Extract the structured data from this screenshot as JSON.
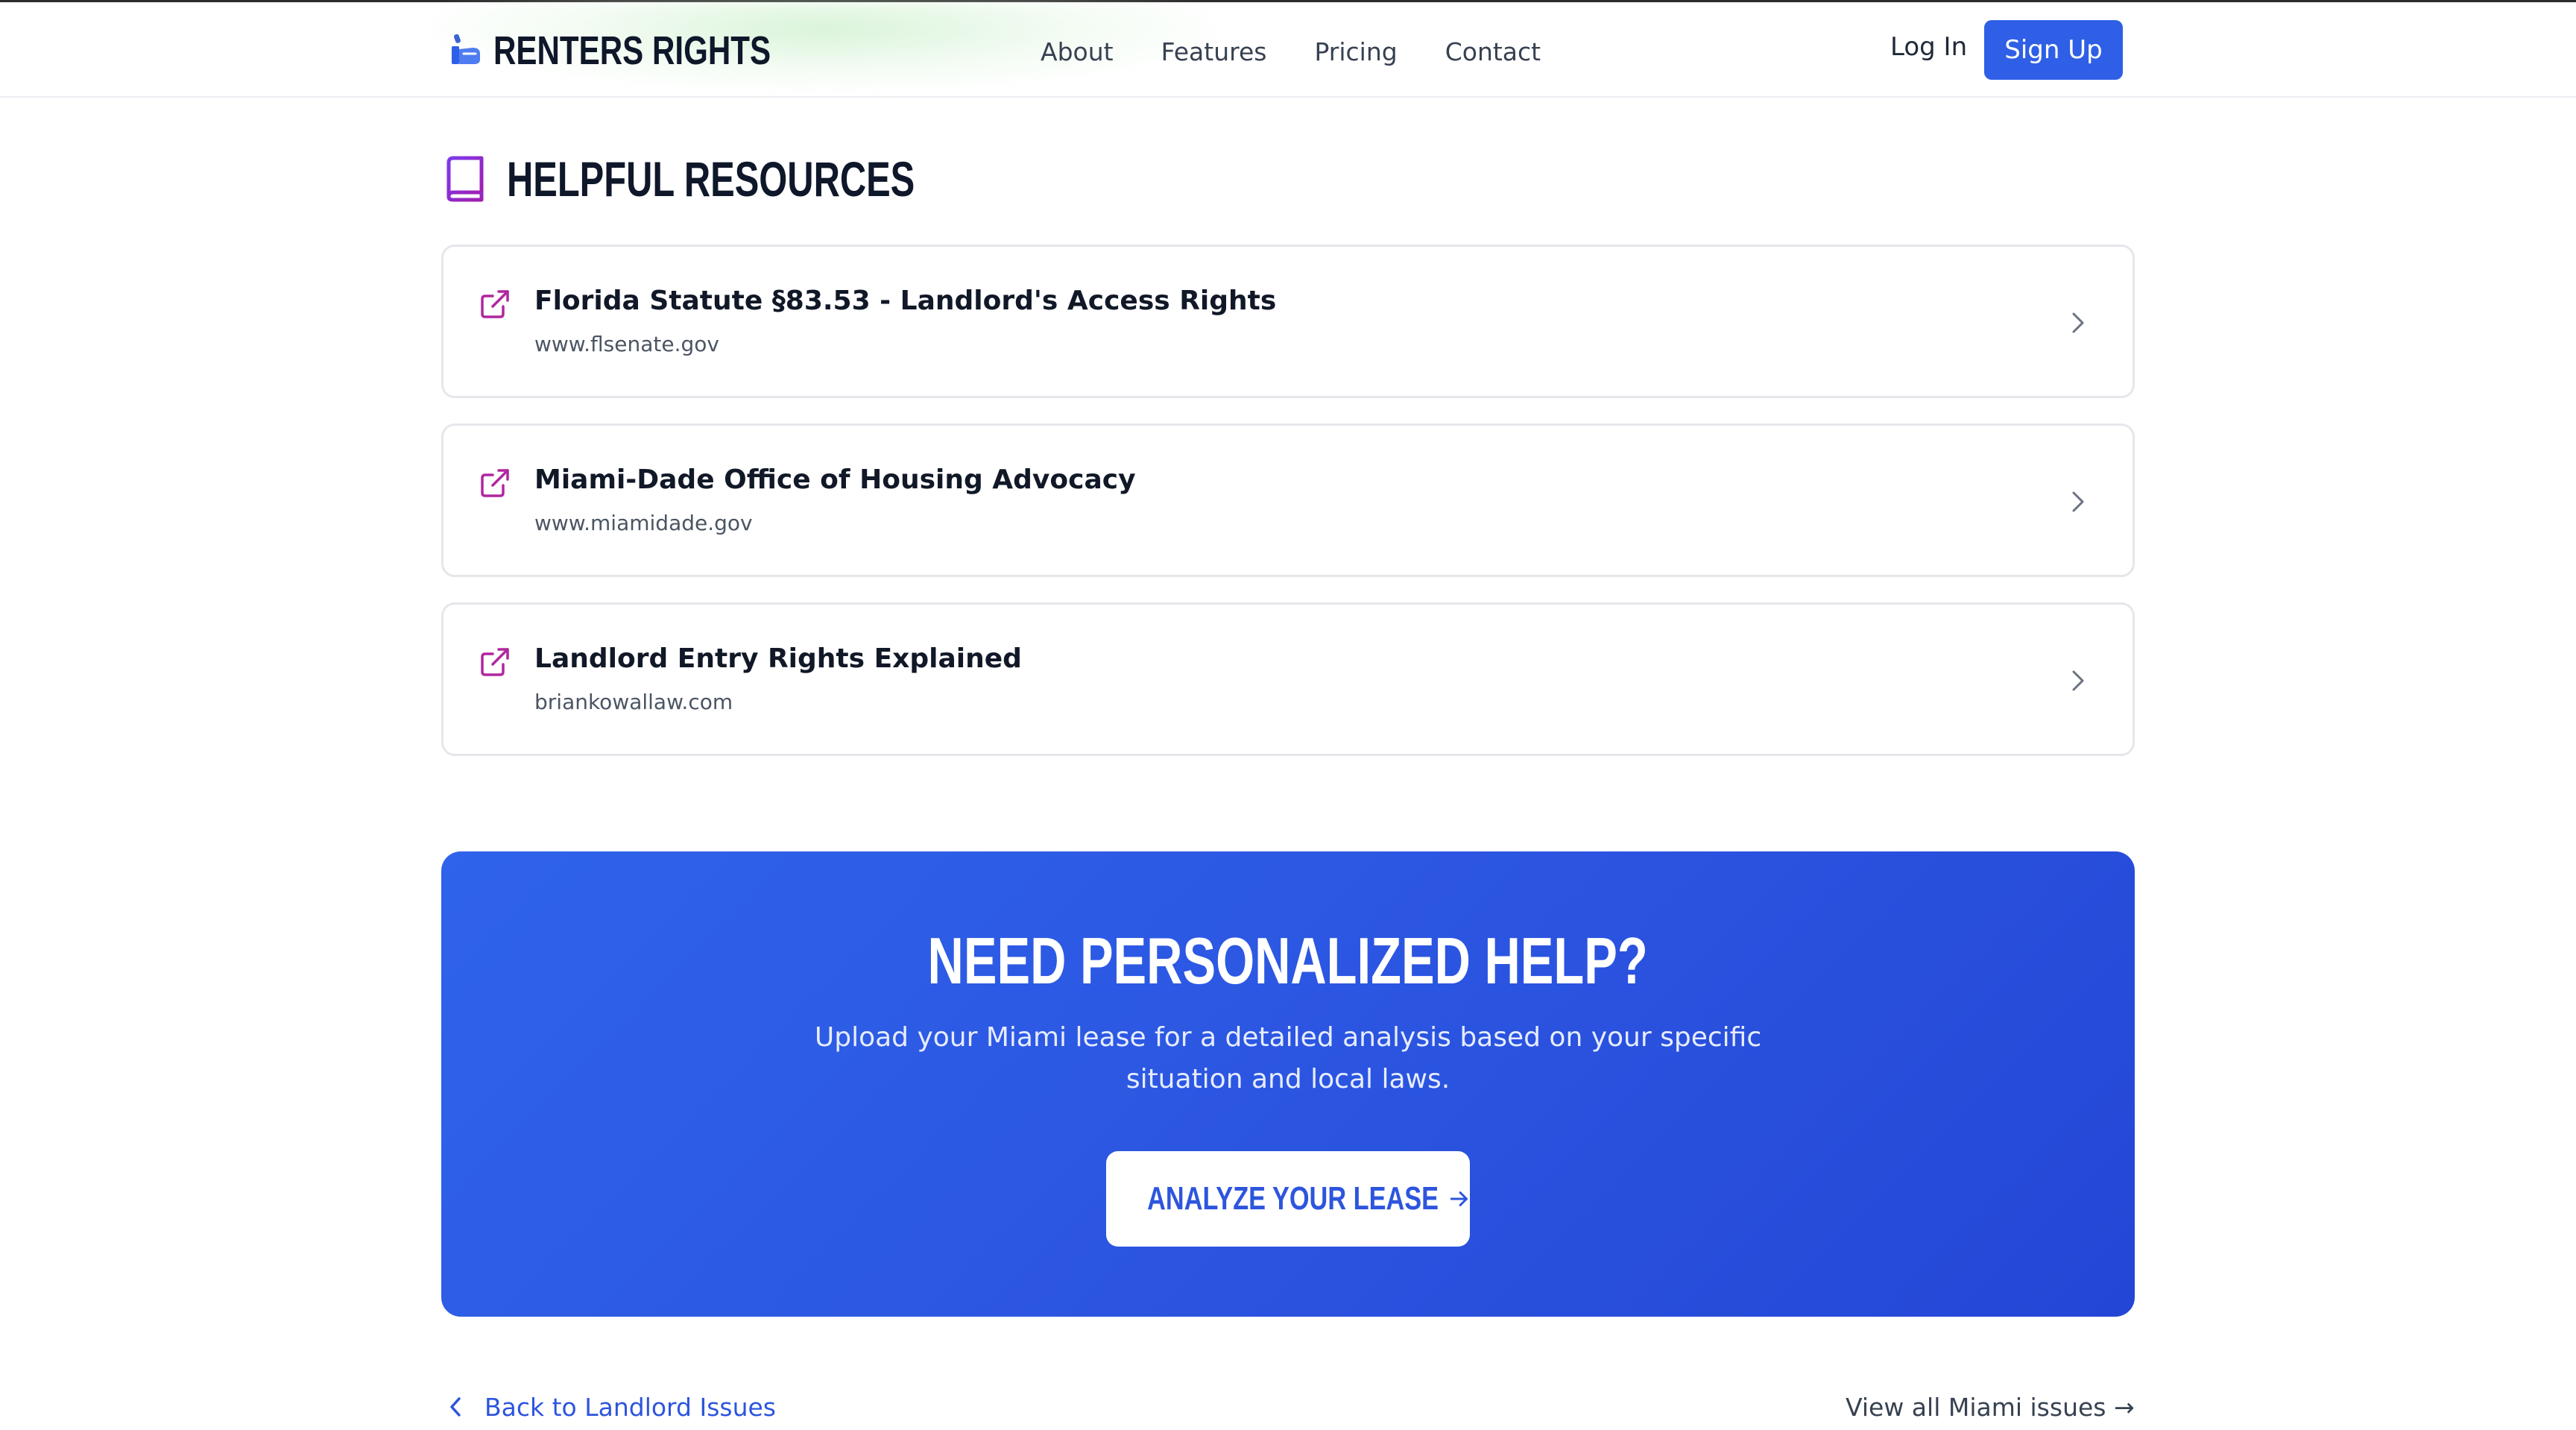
{
  "header": {
    "brand": "RENTERS RIGHTS",
    "nav": [
      "About",
      "Features",
      "Pricing",
      "Contact"
    ],
    "login_label": "Log In",
    "signup_label": "Sign Up"
  },
  "resources": {
    "title": "HELPFUL RESOURCES",
    "items": [
      {
        "title": "Florida Statute §83.53 - Landlord's Access Rights",
        "url": "www.flsenate.gov"
      },
      {
        "title": "Miami-Dade Office of Housing Advocacy",
        "url": "www.miamidade.gov"
      },
      {
        "title": "Landlord Entry Rights Explained",
        "url": "briankowallaw.com"
      }
    ]
  },
  "cta": {
    "title": "NEED PERSONALIZED HELP?",
    "description": "Upload your Miami lease for a detailed analysis based on your specific situation and local laws.",
    "button_label": "ANALYZE YOUR LEASE"
  },
  "footer_nav": {
    "back_label": "Back to Landlord Issues",
    "view_all_label": "View all Miami issues →"
  },
  "colors": {
    "accent": "#2f5fe6",
    "icon_purple": "#a21caf"
  }
}
